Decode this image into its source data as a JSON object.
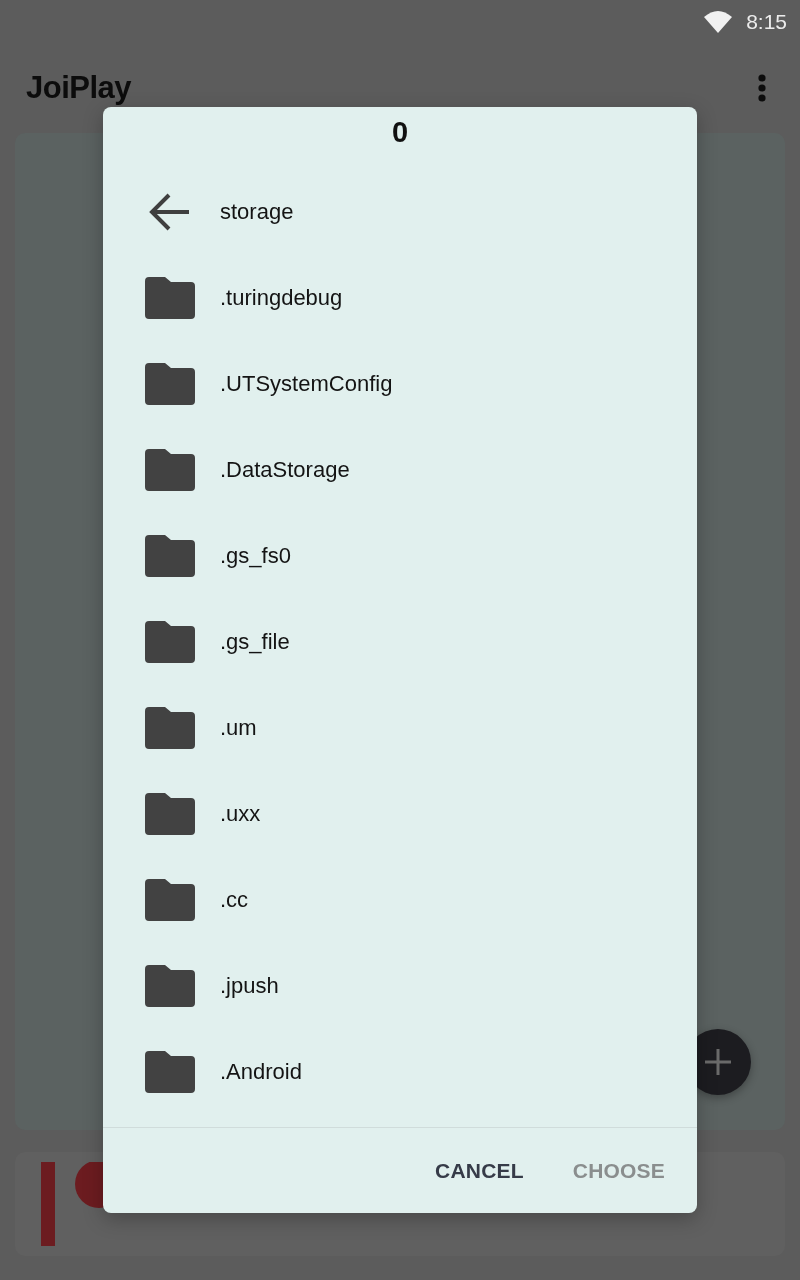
{
  "status_bar": {
    "time": "8:15"
  },
  "app_bar": {
    "title": "JoiPlay"
  },
  "dialog": {
    "title": "0",
    "parent": {
      "label": "storage"
    },
    "items": [
      {
        "name": ".turingdebug"
      },
      {
        "name": ".UTSystemConfig"
      },
      {
        "name": ".DataStorage"
      },
      {
        "name": ".gs_fs0"
      },
      {
        "name": ".gs_file"
      },
      {
        "name": ".um"
      },
      {
        "name": ".uxx"
      },
      {
        "name": ".cc"
      },
      {
        "name": ".jpush"
      },
      {
        "name": ".Android"
      }
    ],
    "buttons": [
      {
        "label": "CANCEL",
        "disabled": false
      },
      {
        "label": "CHOOSE",
        "disabled": true
      }
    ]
  }
}
